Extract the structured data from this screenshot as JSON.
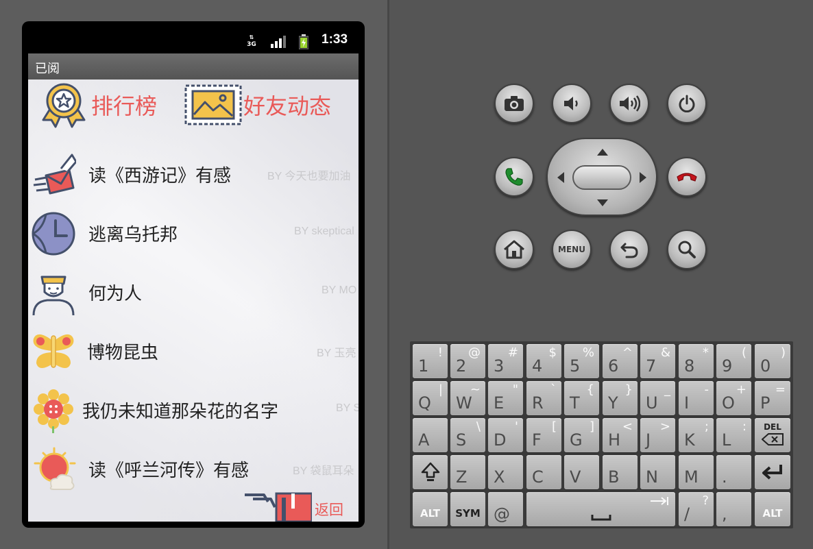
{
  "statusbar": {
    "network": "3G",
    "time": "1:33"
  },
  "app": {
    "title": "已阅"
  },
  "topnav": {
    "ranking_label": "排行榜",
    "friends_label": "好友动态"
  },
  "books": [
    {
      "title": "读《西游记》有感",
      "author": "BY 今天也要加油",
      "icon": "mail-icon"
    },
    {
      "title": "逃离乌托邦",
      "author": "BY skeptical",
      "icon": "globe-clock-icon"
    },
    {
      "title": "何为人",
      "author": "BY MO",
      "icon": "person-icon"
    },
    {
      "title": "博物昆虫",
      "author": "BY 玉亮",
      "icon": "butterfly-icon"
    },
    {
      "title": "我仍未知道那朵花的名字",
      "author": "BY S",
      "icon": "flower-icon"
    },
    {
      "title": "读《呼兰河传》有感",
      "author": "BY 袋鼠耳朵",
      "icon": "sun-cloud-icon"
    }
  ],
  "back": {
    "label": "返回"
  },
  "hardware": {
    "menu_label": "MENU"
  },
  "keyboard": {
    "row1": [
      {
        "main": "1",
        "alt": "!"
      },
      {
        "main": "2",
        "alt": "@"
      },
      {
        "main": "3",
        "alt": "#"
      },
      {
        "main": "4",
        "alt": "$"
      },
      {
        "main": "5",
        "alt": "%"
      },
      {
        "main": "6",
        "alt": "^"
      },
      {
        "main": "7",
        "alt": "&"
      },
      {
        "main": "8",
        "alt": "*"
      },
      {
        "main": "9",
        "alt": "("
      },
      {
        "main": "0",
        "alt": ")"
      }
    ],
    "row2": [
      {
        "main": "Q",
        "alt": "|"
      },
      {
        "main": "W",
        "alt": "~"
      },
      {
        "main": "E",
        "alt": "\""
      },
      {
        "main": "R",
        "alt": "`"
      },
      {
        "main": "T",
        "alt": "{"
      },
      {
        "main": "Y",
        "alt": "}"
      },
      {
        "main": "U",
        "alt": "_"
      },
      {
        "main": "I",
        "alt": "-"
      },
      {
        "main": "O",
        "alt": "+"
      },
      {
        "main": "P",
        "alt": "="
      }
    ],
    "row3": [
      {
        "main": "A",
        "alt": ""
      },
      {
        "main": "S",
        "alt": "\\"
      },
      {
        "main": "D",
        "alt": "'"
      },
      {
        "main": "F",
        "alt": "["
      },
      {
        "main": "G",
        "alt": "]"
      },
      {
        "main": "H",
        "alt": "<"
      },
      {
        "main": "J",
        "alt": ">"
      },
      {
        "main": "K",
        "alt": ";"
      },
      {
        "main": "L",
        "alt": ":"
      }
    ],
    "row4": [
      {
        "main": "Z",
        "alt": ""
      },
      {
        "main": "X",
        "alt": ""
      },
      {
        "main": "C",
        "alt": ""
      },
      {
        "main": "V",
        "alt": ""
      },
      {
        "main": "B",
        "alt": ""
      },
      {
        "main": "N",
        "alt": ""
      },
      {
        "main": "M",
        "alt": ""
      },
      {
        "main": ".",
        "alt": ""
      }
    ],
    "del_label": "DEL",
    "alt_label": "ALT",
    "sym_label": "SYM",
    "at_label": "@",
    "slash_label": "/",
    "slash_alt": "?",
    "comma_label": ","
  }
}
